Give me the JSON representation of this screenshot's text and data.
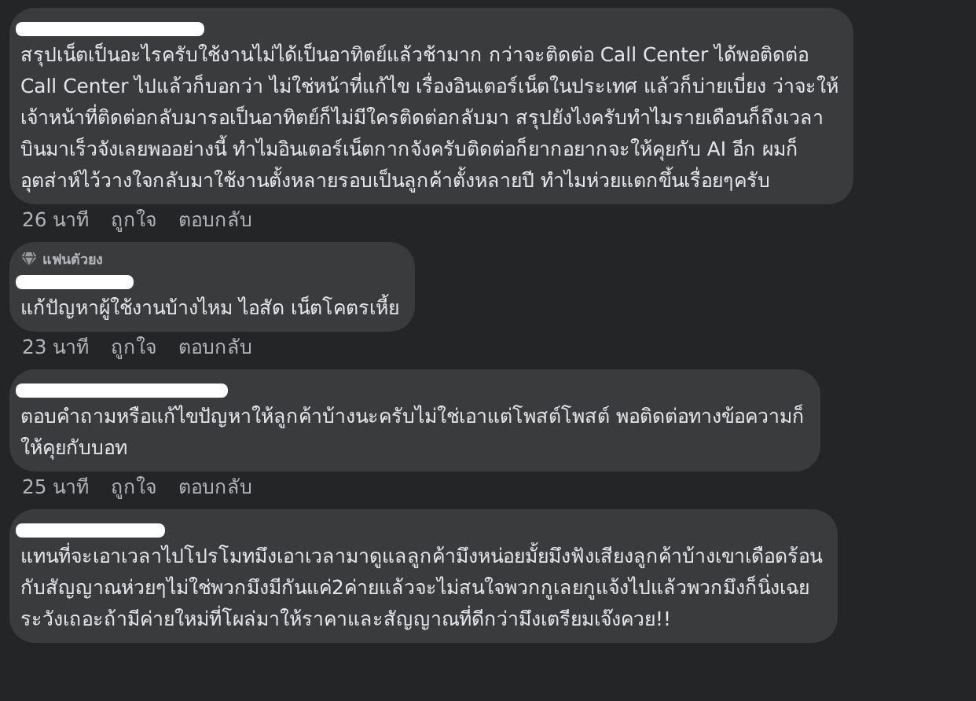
{
  "comments": [
    {
      "author_redacted": true,
      "text": "สรุปเน็ตเป็นอะไรครับใช้งานไม่ได้เป็นอาทิตย์แล้วช้ามาก กว่าจะติดต่อ Call Center ได้พอติดต่อ\nCall Center ไปแล้วก็บอกว่า ไม่ใช่หน้าที่แก้ไข เรื่องอินเตอร์เน็ตในประเทศ แล้วก็บ่ายเบี่ยง ว่าจะให้\nเจ้าหน้าที่ติดต่อกลับมารอเป็นอาทิตย์ก็ไม่มีใครติดต่อกลับมา สรุปยังไงครับทำไมรายเดือนก็ถึงเวลา\nบินมาเร็วจังเลยพออย่างนี้ ทำไมอินเตอร์เน็ตกากจังครับติดต่อก็ยากอยากจะให้คุยกับ AI อีก ผมก็\nอุตส่าห์ไว้วางใจกลับมาใช้งานตั้งหลายรอบเป็นลูกค้าตั้งหลายปี ทำไมห่วยแตกขึ้นเรื่อยๆครับ",
      "time": "26 นาที",
      "like": "ถูกใจ",
      "reply": "ตอบกลับ"
    },
    {
      "author_redacted": true,
      "badge": "แฟนตัวยง",
      "text": "แก้ปัญหาผู้ใช้งานบ้างไหม ไอสัด เน็ตโคตรเหี้ย",
      "time": "23 นาที",
      "like": "ถูกใจ",
      "reply": "ตอบกลับ"
    },
    {
      "author_redacted": true,
      "text": "ตอบคำถามหรือแก้ไขปัญหาให้ลูกค้าบ้างนะครับไม่ใช่เอาแต่โพสต์โพสต์ พอติดต่อทางข้อความก็\nให้คุยกับบอท",
      "time": "25 นาที",
      "like": "ถูกใจ",
      "reply": "ตอบกลับ"
    },
    {
      "author_redacted": true,
      "text": "แทนที่จะเอาเวลาไปโปรโมทมึงเอาเวลามาดูแลลูกค้ามึงหน่อยมั้ยมึงฟังเสียงลูกค้าบ้างเขาเดือดร้อน\nกับสัญญาณห่วยๆไม่ใช่พวกมึงมีกันแค่2ค่ายแล้วจะไม่สนใจพวกกูเลยกูแจ้งไปแล้วพวกมึงก็นิ่งเฉย\nระวังเถอะถ้ามีค่ายใหม่ที่โผล่มาให้ราคาและสัญญาณที่ดีกว่ามึงเตรียมเจ๊งควย!!"
    }
  ]
}
